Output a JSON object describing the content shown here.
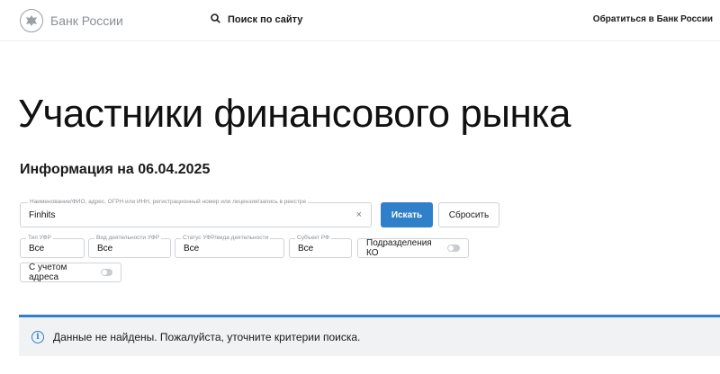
{
  "header": {
    "logo_text": "Банк России",
    "search_label": "Поиск по сайту",
    "contact_label": "Обратиться в Банк России"
  },
  "page": {
    "title": "Участники финансового рынка",
    "info_date": "Информация на 06.04.2025"
  },
  "search": {
    "label": "Наименование/ФИО, адрес, ОГРН или ИНН, регистрационный номер или лицензия/запись в реестре",
    "value": "Finhits",
    "clear": "×",
    "submit_label": "Искать",
    "reset_label": "Сбросить"
  },
  "filters": [
    {
      "label": "Тип УФР",
      "value": "Все"
    },
    {
      "label": "Вид деятельности УФР",
      "value": "Все"
    },
    {
      "label": "Статус УФР/вида деятельности",
      "value": "Все"
    },
    {
      "label": "Субъект РФ",
      "value": "Все"
    }
  ],
  "toggles": {
    "branches": "Подразделения КО",
    "address": "С учетом адреса"
  },
  "alert": {
    "icon": "i",
    "message": "Данные не найдены. Пожалуйста, уточните критерии поиска."
  },
  "colors": {
    "accent": "#2f7fc9",
    "alert_bg": "#f1f2f3"
  }
}
